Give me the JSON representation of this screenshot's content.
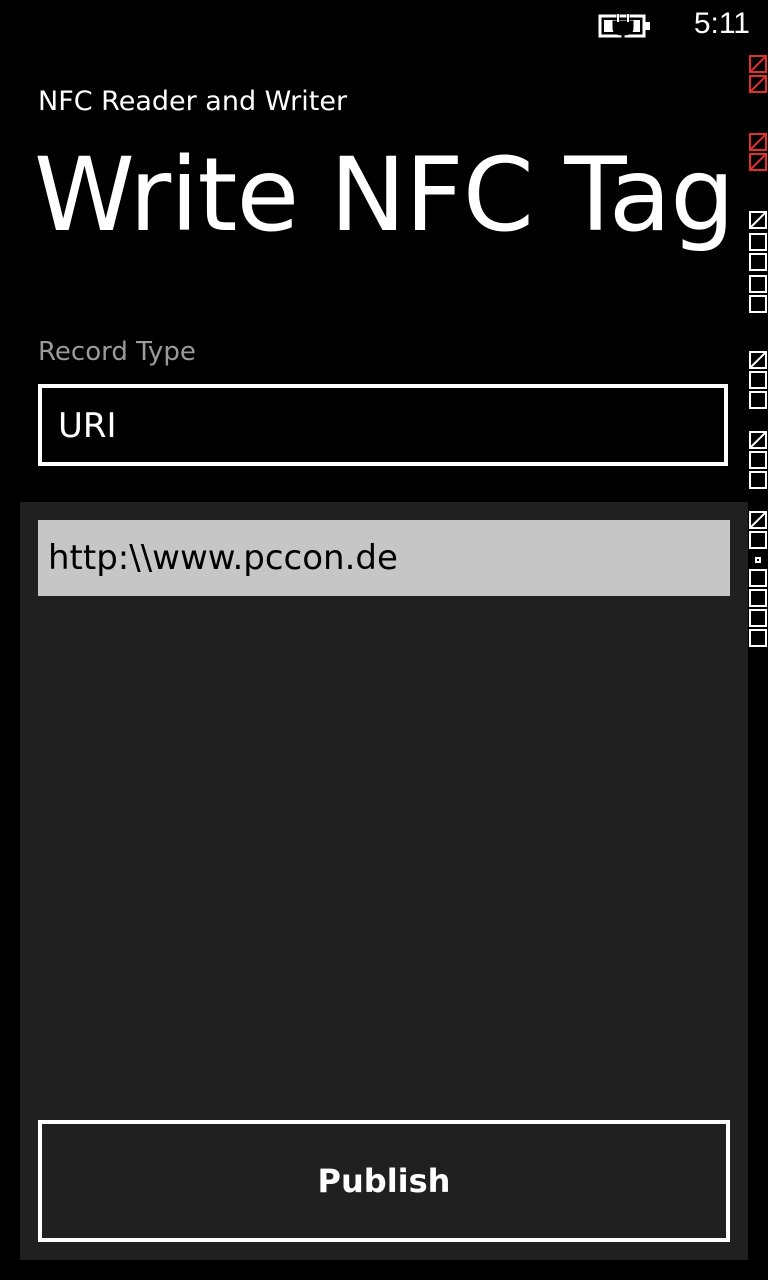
{
  "status_bar": {
    "time": "5:11",
    "battery_icon": "battery-charging-icon"
  },
  "header": {
    "app_title": "NFC Reader and Writer",
    "page_title": "Write NFC Tag"
  },
  "form": {
    "record_type_label": "Record Type",
    "record_type_value": "URI",
    "uri_value": "http:\\\\www.pccon.de",
    "publish_label": "Publish"
  },
  "colors": {
    "background": "#000000",
    "panel": "#202020",
    "input_fill": "#c6c6c6",
    "label_gray": "#9a9a9a",
    "debug_red": "#e0302a"
  }
}
